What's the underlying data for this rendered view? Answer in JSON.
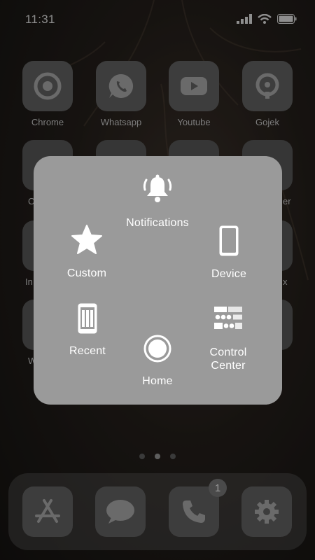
{
  "status_bar": {
    "time": "11:31"
  },
  "apps_row1": [
    {
      "label": "Chrome",
      "icon": "chrome-icon"
    },
    {
      "label": "Whatsapp",
      "icon": "whatsapp-icon"
    },
    {
      "label": "Youtube",
      "icon": "youtube-icon"
    },
    {
      "label": "Gojek",
      "icon": "gojek-icon"
    }
  ],
  "partial_labels": {
    "row2_left": "C",
    "row2_right": "er",
    "row3_left": "In",
    "row3_right": "x",
    "row4_left": "W"
  },
  "assistive_menu": {
    "notifications": "Notifications",
    "custom": "Custom",
    "device": "Device",
    "recent": "Recent",
    "home": "Home",
    "control_center_line1": "Control",
    "control_center_line2": "Center"
  },
  "dock": {
    "phone_badge": "1",
    "apps": [
      "app-store-icon",
      "messages-icon",
      "phone-icon",
      "settings-icon"
    ]
  },
  "colors": {
    "panel": "#9a9a9a",
    "tile": "#3d3d3d",
    "text_dim": "#7d7d7d"
  }
}
